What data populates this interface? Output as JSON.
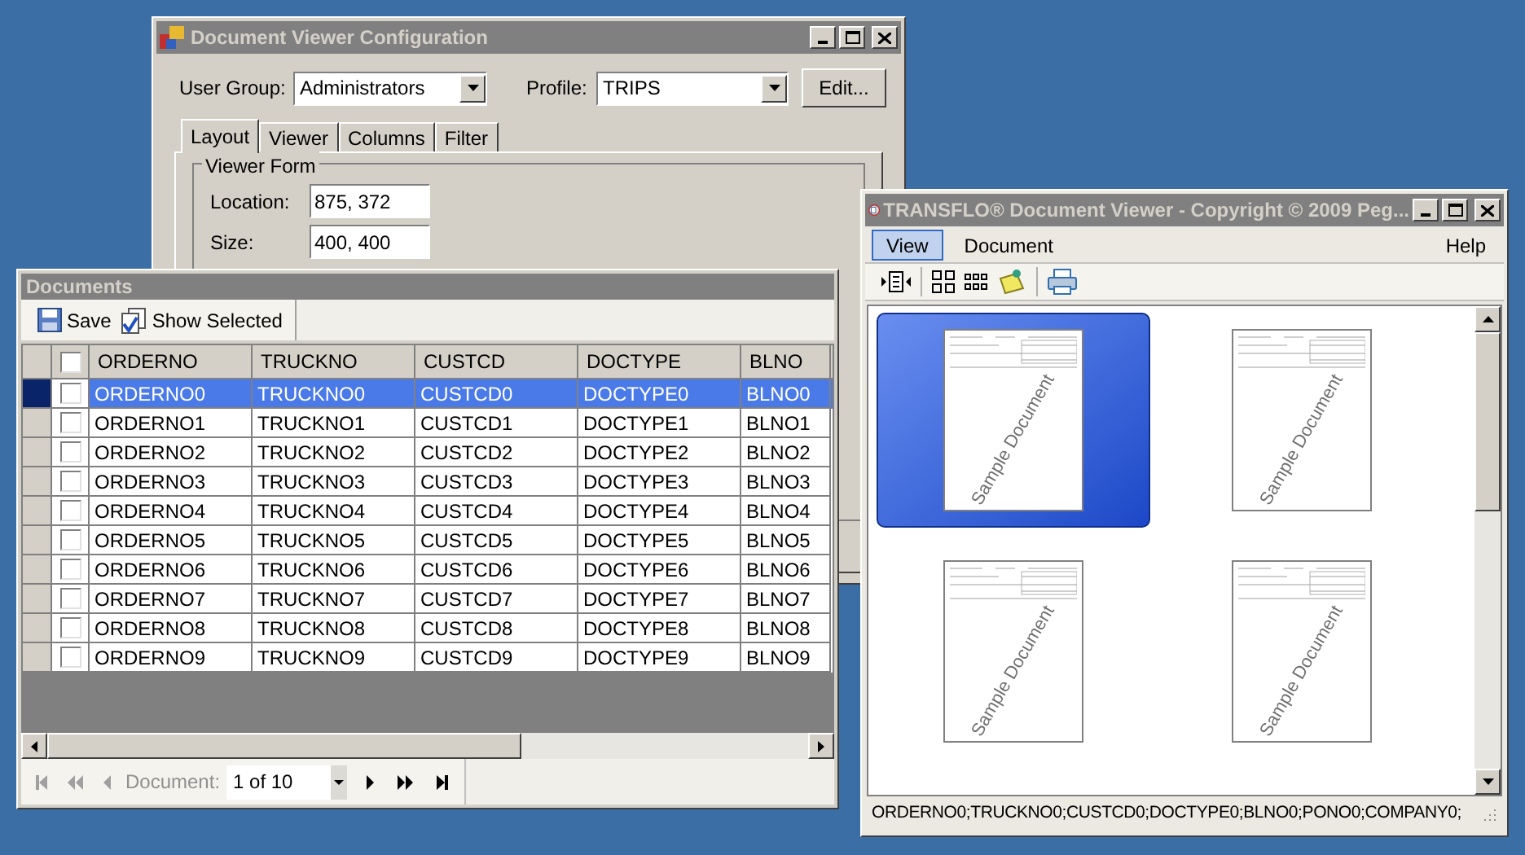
{
  "config_window": {
    "title": "Document Viewer Configuration",
    "user_group": {
      "label": "User Group:",
      "value": "Administrators"
    },
    "profile": {
      "label": "Profile:",
      "value": "TRIPS"
    },
    "edit_button": "Edit...",
    "tabs": [
      {
        "label": "Layout",
        "selected": true
      },
      {
        "label": "Viewer",
        "selected": false
      },
      {
        "label": "Columns",
        "selected": false
      },
      {
        "label": "Filter",
        "selected": false
      }
    ],
    "viewer_form": {
      "title": "Viewer Form",
      "fields": [
        {
          "label": "Location:",
          "value": "875, 372"
        },
        {
          "label": "Size:",
          "value": "400, 400"
        }
      ]
    }
  },
  "documents_window": {
    "title": "Documents",
    "toolbar": [
      {
        "kind": "save",
        "label": "Save"
      },
      {
        "kind": "show_selected",
        "label": "Show Selected"
      }
    ],
    "table": {
      "header_checked": false,
      "columns": [
        "ORDERNO",
        "TRUCKNO",
        "CUSTCD",
        "DOCTYPE",
        "BLNO"
      ],
      "rows": [
        {
          "selected": true,
          "checked": false,
          "cells": [
            "ORDERNO0",
            "TRUCKNO0",
            "CUSTCD0",
            "DOCTYPE0",
            "BLNO0"
          ]
        },
        {
          "selected": false,
          "checked": false,
          "cells": [
            "ORDERNO1",
            "TRUCKNO1",
            "CUSTCD1",
            "DOCTYPE1",
            "BLNO1"
          ]
        },
        {
          "selected": false,
          "checked": false,
          "cells": [
            "ORDERNO2",
            "TRUCKNO2",
            "CUSTCD2",
            "DOCTYPE2",
            "BLNO2"
          ]
        },
        {
          "selected": false,
          "checked": false,
          "cells": [
            "ORDERNO3",
            "TRUCKNO3",
            "CUSTCD3",
            "DOCTYPE3",
            "BLNO3"
          ]
        },
        {
          "selected": false,
          "checked": false,
          "cells": [
            "ORDERNO4",
            "TRUCKNO4",
            "CUSTCD4",
            "DOCTYPE4",
            "BLNO4"
          ]
        },
        {
          "selected": false,
          "checked": false,
          "cells": [
            "ORDERNO5",
            "TRUCKNO5",
            "CUSTCD5",
            "DOCTYPE5",
            "BLNO5"
          ]
        },
        {
          "selected": false,
          "checked": false,
          "cells": [
            "ORDERNO6",
            "TRUCKNO6",
            "CUSTCD6",
            "DOCTYPE6",
            "BLNO6"
          ]
        },
        {
          "selected": false,
          "checked": false,
          "cells": [
            "ORDERNO7",
            "TRUCKNO7",
            "CUSTCD7",
            "DOCTYPE7",
            "BLNO7"
          ]
        },
        {
          "selected": false,
          "checked": false,
          "cells": [
            "ORDERNO8",
            "TRUCKNO8",
            "CUSTCD8",
            "DOCTYPE8",
            "BLNO8"
          ]
        },
        {
          "selected": false,
          "checked": false,
          "cells": [
            "ORDERNO9",
            "TRUCKNO9",
            "CUSTCD9",
            "DOCTYPE9",
            "BLNO9"
          ]
        }
      ]
    },
    "pager": {
      "label": "Document:",
      "value": "1 of 10",
      "buttons": [
        {
          "kind": "first",
          "disabled": true
        },
        {
          "kind": "prev_page",
          "disabled": true
        },
        {
          "kind": "prev",
          "disabled": true
        },
        {
          "kind": "next",
          "disabled": false
        },
        {
          "kind": "next_page",
          "disabled": false
        },
        {
          "kind": "last",
          "disabled": false
        }
      ]
    }
  },
  "viewer_window": {
    "title": "TRANSFLO® Document Viewer - Copyright © 2009 Peg...",
    "menu": [
      {
        "label": "View",
        "selected": true
      },
      {
        "label": "Document",
        "selected": false
      },
      {
        "label": "Help",
        "selected": false
      }
    ],
    "thumbnails": [
      {
        "caption": "Sample Document",
        "selected": true
      },
      {
        "caption": "Sample Document",
        "selected": false
      },
      {
        "caption": "Sample Document",
        "selected": false
      },
      {
        "caption": "Sample Document",
        "selected": false
      }
    ],
    "status_bar": "ORDERNO0;TRUCKNO0;CUSTCD0;DOCTYPE0;BLNO0;PONO0;COMPANY0;"
  }
}
